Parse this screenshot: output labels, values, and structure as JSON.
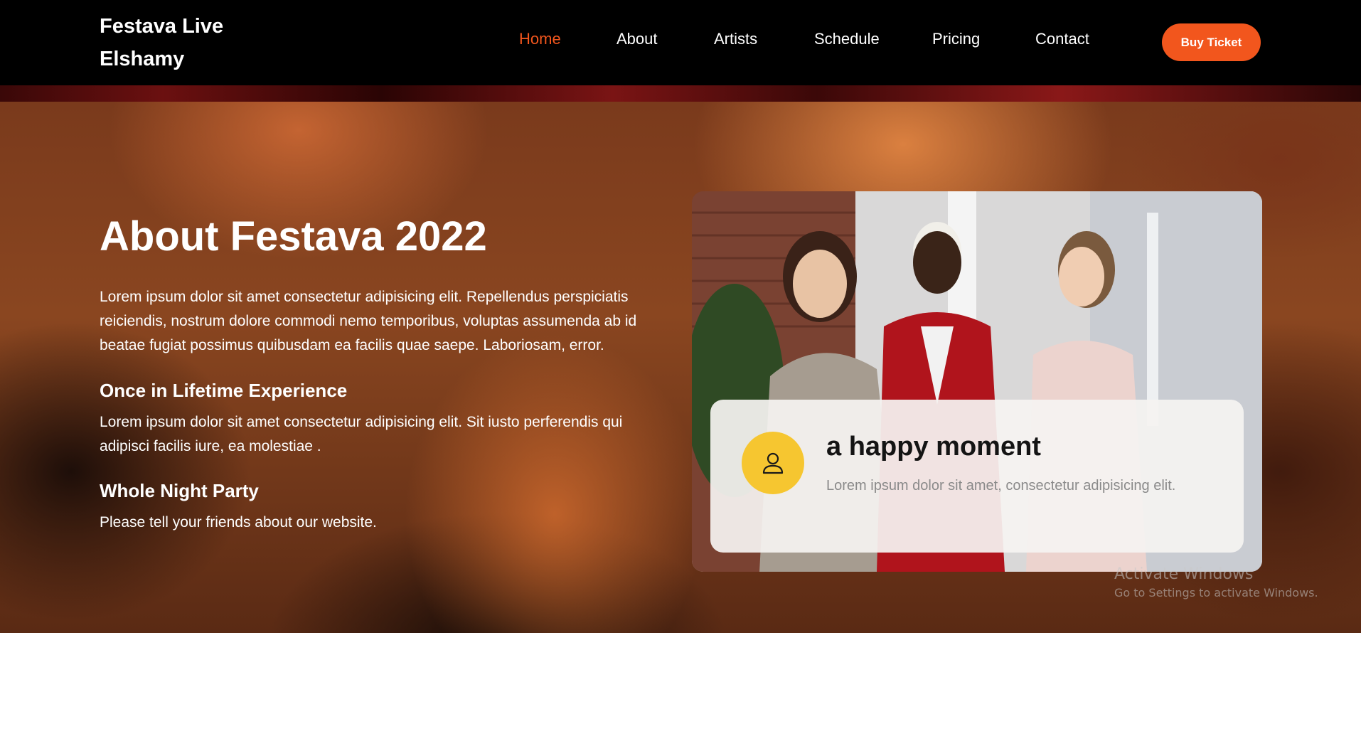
{
  "navbar": {
    "brand_line1": "Festava Live",
    "brand_line2": "Elshamy",
    "links": [
      {
        "label": "Home",
        "active": true
      },
      {
        "label": "About"
      },
      {
        "label": "Artists"
      },
      {
        "label": "Schedule"
      },
      {
        "label": "Pricing"
      },
      {
        "label": "Contact"
      }
    ],
    "cta_label": "Buy Ticket"
  },
  "about": {
    "title": "About Festava 2022",
    "body": "Lorem ipsum dolor sit amet consectetur adipisicing elit. Repellendus perspiciatis reiciendis, nostrum dolore commodi nemo temporibus, voluptas assumenda ab id beatae fugiat possimus quibusdam ea facilis quae saepe. Laboriosam, error.",
    "features": [
      {
        "heading": "Once in Lifetime Experience",
        "text": "Lorem ipsum dolor sit amet consectetur adipisicing elit. Sit iusto perferendis qui adipisci facilis iure, ea molestiae ."
      },
      {
        "heading": "Whole Night Party",
        "text": "Please tell your friends about our website."
      }
    ]
  },
  "moment_card": {
    "icon": "person-icon",
    "title": "a happy moment",
    "text": "Lorem ipsum dolor sit amet, consectetur adipisicing elit."
  },
  "watermark": {
    "line1": "Activate Windows",
    "line2": "Go to Settings to activate Windows."
  },
  "colors": {
    "accent": "#f2561d",
    "avatar": "#f6c630",
    "navbar_bg": "#000000"
  }
}
